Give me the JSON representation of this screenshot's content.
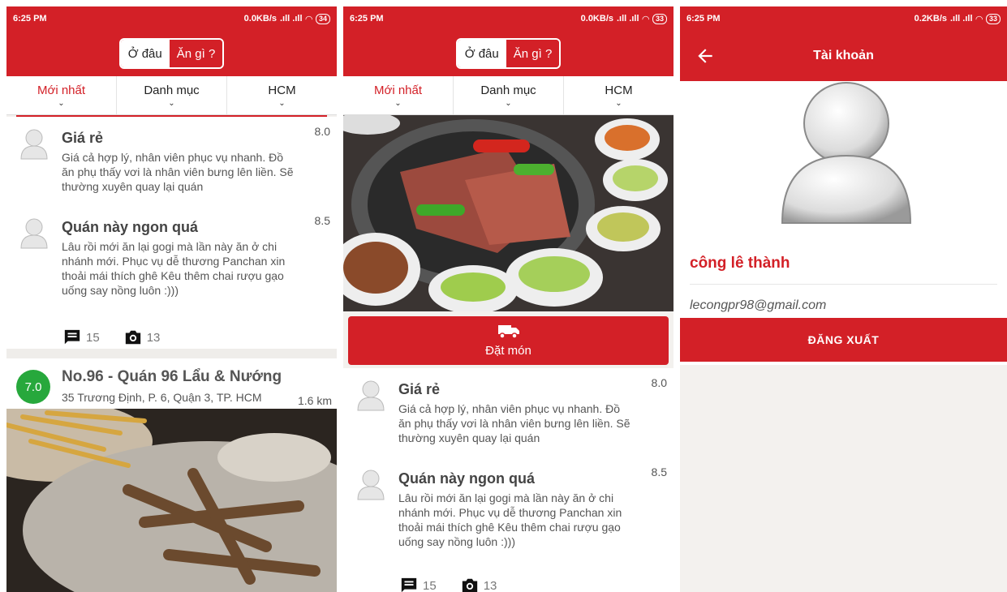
{
  "status": {
    "time": "6:25 PM",
    "p1_net": "0.0KB/s",
    "p1_batt": "34",
    "p2_net": "0.0KB/s",
    "p2_batt": "33",
    "p3_net": "0.2KB/s",
    "p3_batt": "33"
  },
  "toggle": {
    "where": "Ở đâu",
    "what": "Ăn gì ?"
  },
  "tabs": [
    "Mới nhất",
    "Danh mục",
    "HCM"
  ],
  "reviews": [
    {
      "title": "Giá rẻ",
      "score": "8.0",
      "body": "Giá cả hợp lý, nhân viên phục vụ nhanh. Đồ ăn phụ thấy vơi là nhân viên bưng lên liền. Sẽ thường xuyên quay lại quán"
    },
    {
      "title": "Quán này ngon quá",
      "score": "8.5",
      "body": "Lâu rồi mới ăn lại gogi mà lần này ăn ở chi nhánh mới.  Phục vụ dễ thương Panchan xin thoải mái thích ghê Kêu thêm chai rượu gạo uống say nồng luôn :)))"
    }
  ],
  "stats": {
    "comments": "15",
    "photos": "13"
  },
  "place": {
    "rating": "7.0",
    "name": "No.96 - Quán 96 Lẩu & Nướng",
    "address": "35 Trương Định, P. 6, Quận 3, TP. HCM",
    "distance": "1.6 km"
  },
  "order": {
    "label": "Đặt món"
  },
  "account": {
    "title": "Tài khoản",
    "name": "công lê thành",
    "email": "lecongpr98@gmail.com",
    "logout": "ĐĂNG XUẤT"
  },
  "colors": {
    "brand": "#d32027",
    "rating": "#27a83c"
  }
}
